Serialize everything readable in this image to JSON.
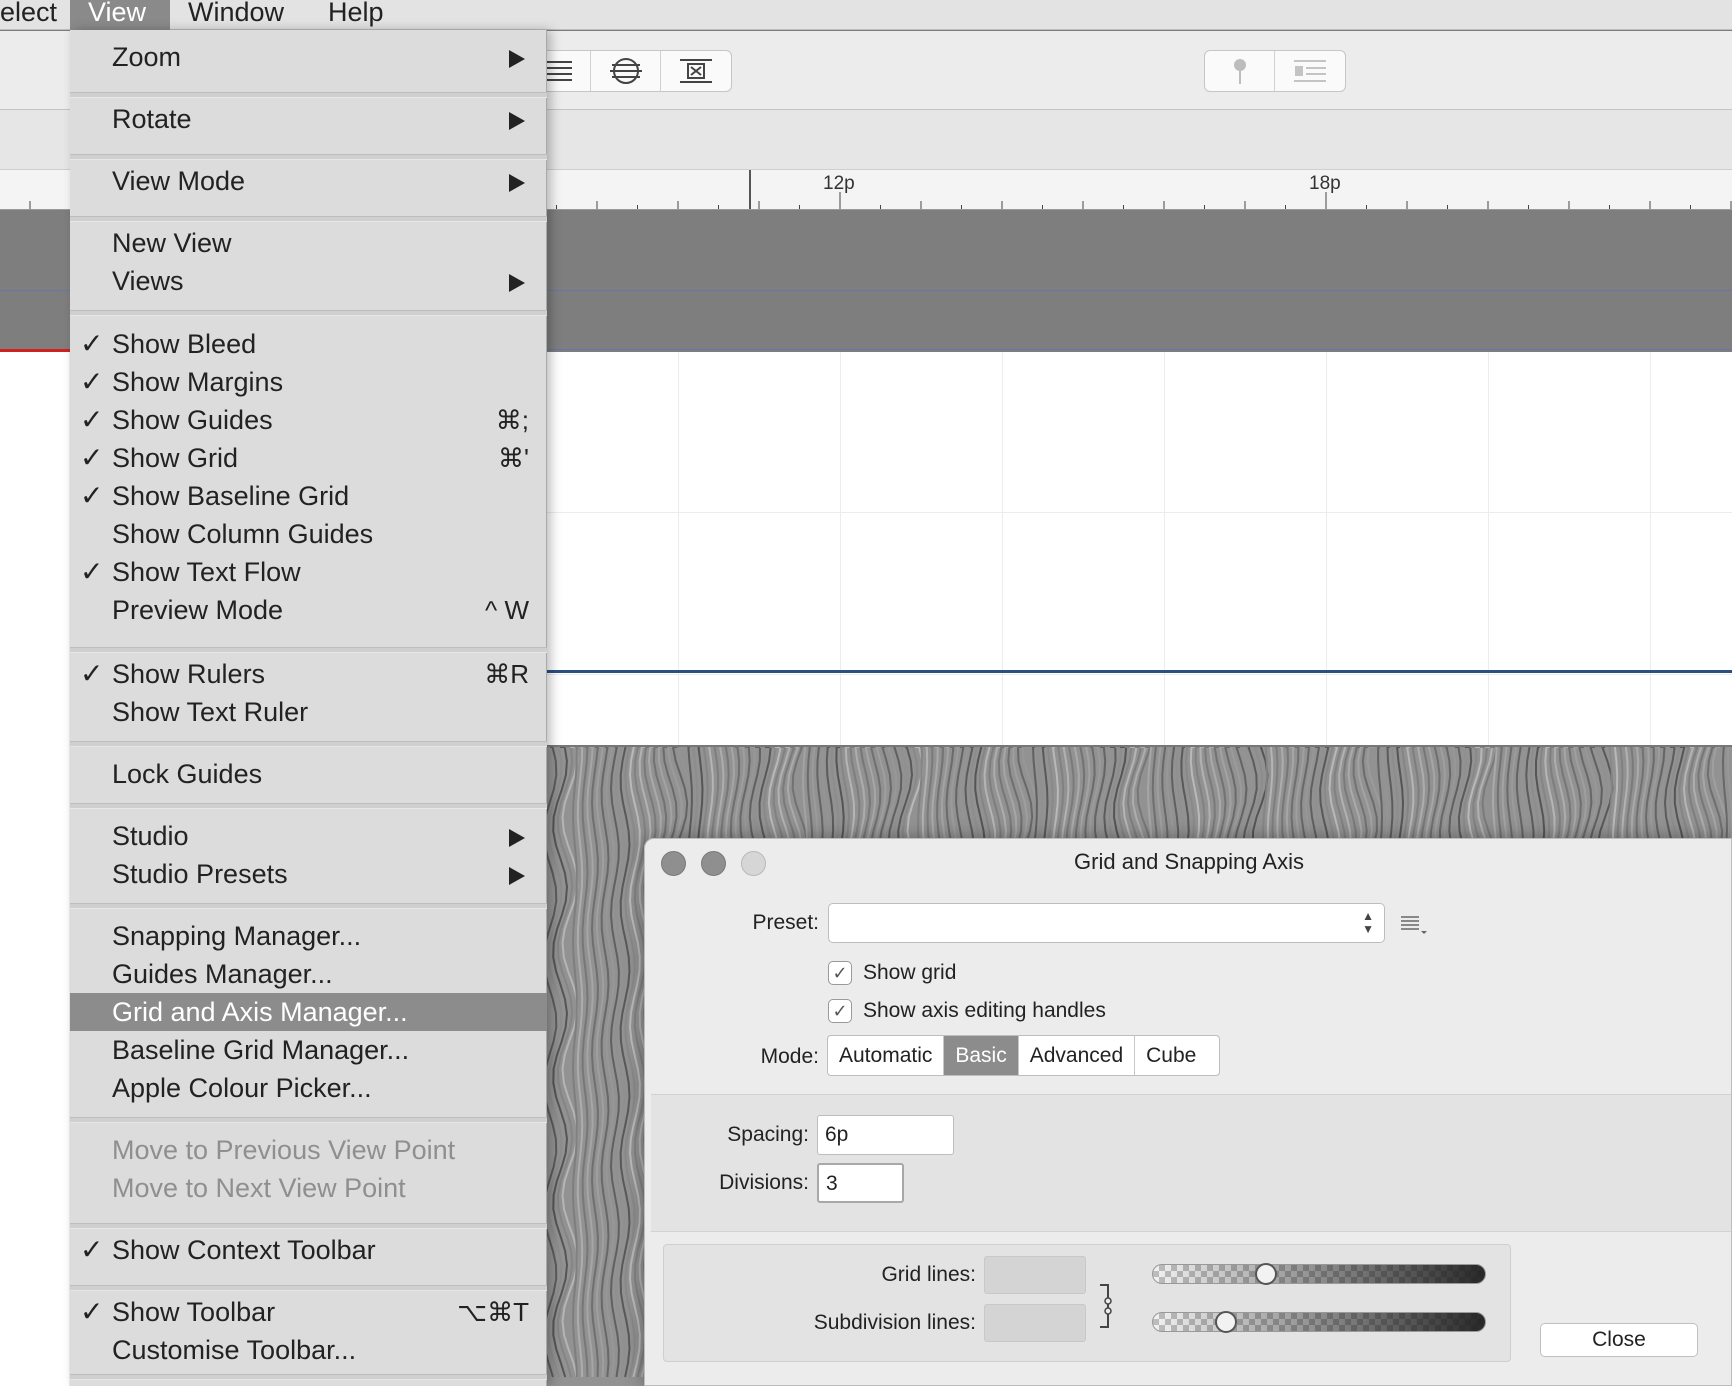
{
  "menubar": {
    "items": [
      {
        "label": "elect"
      },
      {
        "label": "View"
      },
      {
        "label": "Window"
      },
      {
        "label": "Help"
      }
    ]
  },
  "ruler": {
    "labels": [
      "12p",
      "18p"
    ]
  },
  "view_menu": {
    "items": [
      {
        "label": "Zoom",
        "checked": false,
        "submenu": true,
        "shortcut": ""
      },
      {
        "label": "Rotate",
        "checked": false,
        "submenu": true,
        "shortcut": ""
      },
      {
        "label": "View Mode",
        "checked": false,
        "submenu": true,
        "shortcut": ""
      },
      {
        "label": "New View",
        "checked": false,
        "submenu": false,
        "shortcut": ""
      },
      {
        "label": "Views",
        "checked": false,
        "submenu": true,
        "shortcut": ""
      },
      {
        "label": "Show Bleed",
        "checked": true,
        "submenu": false,
        "shortcut": ""
      },
      {
        "label": "Show Margins",
        "checked": true,
        "submenu": false,
        "shortcut": ""
      },
      {
        "label": "Show Guides",
        "checked": true,
        "submenu": false,
        "shortcut": "⌘;"
      },
      {
        "label": "Show Grid",
        "checked": true,
        "submenu": false,
        "shortcut": "⌘'"
      },
      {
        "label": "Show Baseline Grid",
        "checked": true,
        "submenu": false,
        "shortcut": ""
      },
      {
        "label": "Show Column Guides",
        "checked": false,
        "submenu": false,
        "shortcut": ""
      },
      {
        "label": "Show Text Flow",
        "checked": true,
        "submenu": false,
        "shortcut": ""
      },
      {
        "label": "Preview Mode",
        "checked": false,
        "submenu": false,
        "shortcut": "^ W"
      },
      {
        "label": "Show Rulers",
        "checked": true,
        "submenu": false,
        "shortcut": "⌘R"
      },
      {
        "label": "Show Text Ruler",
        "checked": false,
        "submenu": false,
        "shortcut": ""
      },
      {
        "label": "Lock Guides",
        "checked": false,
        "submenu": false,
        "shortcut": ""
      },
      {
        "label": "Studio",
        "checked": false,
        "submenu": true,
        "shortcut": ""
      },
      {
        "label": "Studio Presets",
        "checked": false,
        "submenu": true,
        "shortcut": ""
      },
      {
        "label": "Snapping Manager...",
        "checked": false,
        "submenu": false,
        "shortcut": ""
      },
      {
        "label": "Guides Manager...",
        "checked": false,
        "submenu": false,
        "shortcut": ""
      },
      {
        "label": "Grid and Axis Manager...",
        "checked": false,
        "submenu": false,
        "shortcut": "",
        "selected": true
      },
      {
        "label": "Baseline Grid Manager...",
        "checked": false,
        "submenu": false,
        "shortcut": ""
      },
      {
        "label": "Apple Colour Picker...",
        "checked": false,
        "submenu": false,
        "shortcut": ""
      },
      {
        "label": "Move to Previous View Point",
        "checked": false,
        "submenu": false,
        "shortcut": "",
        "disabled": true
      },
      {
        "label": "Move to Next View Point",
        "checked": false,
        "submenu": false,
        "shortcut": "",
        "disabled": true
      },
      {
        "label": "Show Context Toolbar",
        "checked": true,
        "submenu": false,
        "shortcut": ""
      },
      {
        "label": "Show Toolbar",
        "checked": true,
        "submenu": false,
        "shortcut": "⌥⌘T"
      },
      {
        "label": "Customise Toolbar...",
        "checked": false,
        "submenu": false,
        "shortcut": ""
      }
    ],
    "check_glyph": "✓"
  },
  "dialog": {
    "title": "Grid and Snapping Axis",
    "preset_label": "Preset:",
    "preset_value": "",
    "show_grid_label": "Show grid",
    "show_grid_checked": true,
    "show_axis_label": "Show axis editing handles",
    "show_axis_checked": true,
    "mode_label": "Mode:",
    "modes": [
      "Automatic",
      "Basic",
      "Advanced",
      "Cube"
    ],
    "selected_mode": "Basic",
    "spacing_label": "Spacing:",
    "spacing_value": "6p",
    "divisions_label": "Divisions:",
    "divisions_value": "3",
    "grid_lines_label": "Grid lines:",
    "subdivision_lines_label": "Subdivision lines:",
    "grid_lines_opacity": 0.33,
    "subdivision_lines_opacity": 0.2,
    "close_label": "Close"
  },
  "colors": {
    "menu_bg": "#dcdcdc",
    "selection": "#8c8c8c",
    "pasteboard": "#7e7e7e",
    "bleed": "#d12020",
    "margin": "#2c4f7e"
  }
}
